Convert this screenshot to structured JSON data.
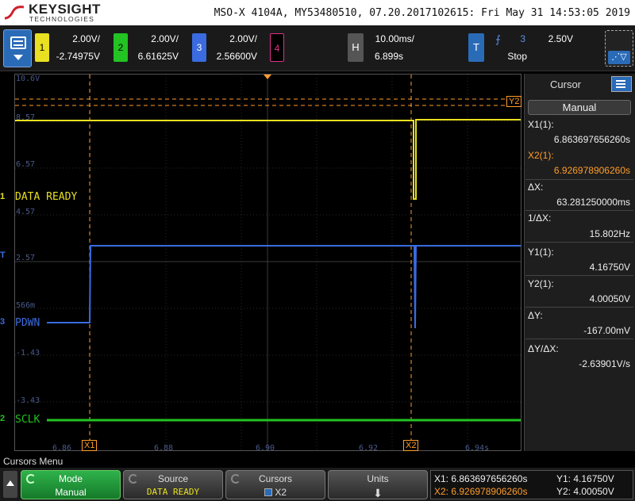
{
  "header": {
    "brand": "KEYSIGHT",
    "brand_sub": "TECHNOLOGIES",
    "info": "MSO-X 4104A, MY53480510, 07.20.2017102615: Fri May 31 14:53:05 2019"
  },
  "channels": [
    {
      "num": "1",
      "scale": "2.00V/",
      "offset": "-2.74975V",
      "color": "#e8e020"
    },
    {
      "num": "2",
      "scale": "2.00V/",
      "offset": "6.61625V",
      "color": "#22c322"
    },
    {
      "num": "3",
      "scale": "2.00V/",
      "offset": "2.56600V",
      "color": "#3a6be0"
    },
    {
      "num": "4",
      "color": "#e0308a"
    }
  ],
  "horizontal": {
    "tab": "H",
    "scale": "10.00ms/",
    "position": "6.899s"
  },
  "trigger": {
    "tab": "T",
    "slope_icon": "rising-edge",
    "source": "3",
    "level": "2.50V",
    "state": "Stop"
  },
  "grid": {
    "y_labels": [
      "10.6V",
      "8.57",
      "6.57",
      "4.57",
      "2.57",
      "566m",
      "-1.43",
      "-3.43"
    ],
    "x_labels": [
      "6.86",
      "6.88",
      "6.90",
      "6.92",
      "6.94s"
    ]
  },
  "traces": {
    "ch1_label": "DATA READY",
    "ch3_label": "PDWN",
    "ch2_label": "SCLK",
    "ch1_marker": "1",
    "ch2_marker": "2",
    "ch3_marker": "3",
    "trigger_marker": "T"
  },
  "cursors": {
    "x1_tag": "X1",
    "x2_tag": "X2",
    "y2_tag": "Y2"
  },
  "panel": {
    "title": "Cursor",
    "mode": "Manual",
    "x1_label": "X1(1):",
    "x1_value": "6.863697656260s",
    "x2_label": "X2(1):",
    "x2_value": "6.926978906260s",
    "dx_label": "ΔX:",
    "dx_value": "63.281250000ms",
    "inv_dx_label": "1/ΔX:",
    "inv_dx_value": "15.802Hz",
    "y1_label": "Y1(1):",
    "y1_value": "4.16750V",
    "y2_label": "Y2(1):",
    "y2_value": "4.00050V",
    "dy_label": "ΔY:",
    "dy_value": "-167.00mV",
    "dydx_label": "ΔY/ΔX:",
    "dydx_value": "-2.63901V/s"
  },
  "bottom": {
    "menu_title": "Cursors Menu",
    "keys": [
      {
        "line1": "Mode",
        "line2": "Manual"
      },
      {
        "line1": "Source",
        "line2": "DATA READY"
      },
      {
        "line1": "Cursors",
        "line2": "X2"
      },
      {
        "line1": "Units",
        "line2": ""
      }
    ],
    "info": {
      "x1": "X1: 6.863697656260s",
      "x2": "X2: 6.926978906260s",
      "y1": "Y1: 4.16750V",
      "y2": "Y2: 4.00050V"
    }
  }
}
